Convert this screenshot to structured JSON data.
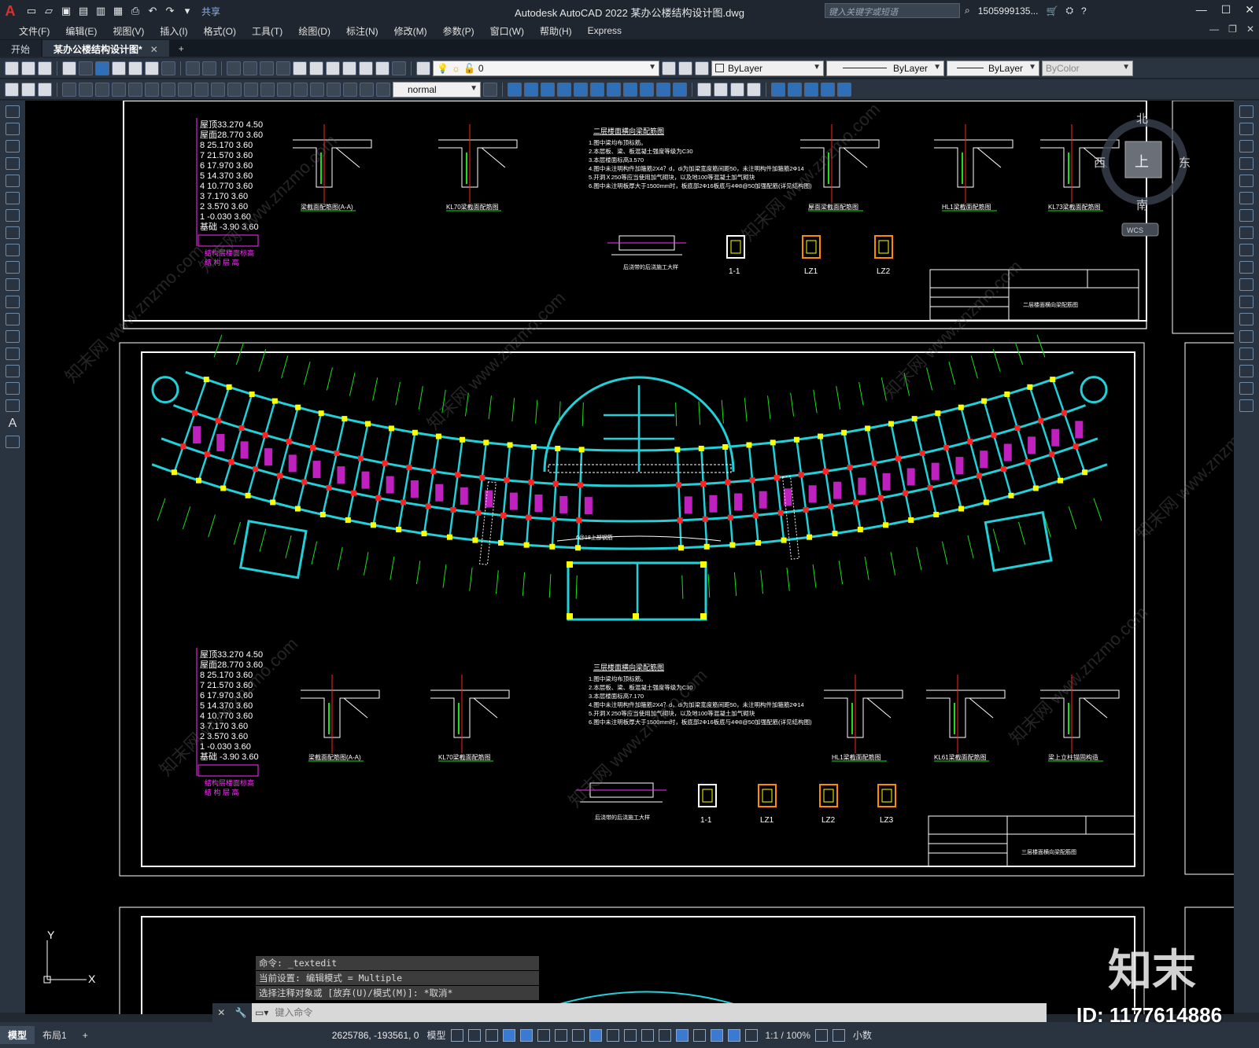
{
  "titlebar": {
    "app_title": "Autodesk AutoCAD 2022    某办公楼结构设计图.dwg",
    "share_label": "共享",
    "search_placeholder": "键入关键字或短语",
    "account": "1505999135...",
    "logo": "A"
  },
  "menu": [
    "文件(F)",
    "编辑(E)",
    "视图(V)",
    "插入(I)",
    "格式(O)",
    "工具(T)",
    "绘图(D)",
    "标注(N)",
    "修改(M)",
    "参数(P)",
    "窗口(W)",
    "帮助(H)",
    "Express"
  ],
  "tabs": {
    "start": "开始",
    "active": "某办公楼结构设计图*",
    "close": "✕",
    "add": "+"
  },
  "toolbar": {
    "layer_value": "0",
    "style_value": "normal",
    "color_value": "ByLayer",
    "linetype_value": "ByLayer",
    "lineweight_value": "ByLayer",
    "plotstyle_value": "ByColor"
  },
  "viewcube": {
    "north": "北",
    "south": "南",
    "east": "东",
    "west": "西",
    "top": "上",
    "wcs": "WCS"
  },
  "drawing": {
    "elev_table_1": [
      "屋顶33.270 4.50",
      "屋面28.770 3.60",
      "8 25.170 3.60",
      "7 21.570 3.60",
      "6 17.970 3.60",
      "5 14.370 3.60",
      "4 10.770 3.60",
      "3 7.170 3.60",
      "2 3.570 3.60",
      "1 -0.030 3.60",
      "基础 -3.90 3.60"
    ],
    "elev_caption": [
      "结构层楼面标高",
      "结 构 层 高"
    ],
    "title_top": "二层楼面横向梁配筋图",
    "title_bottom": "三层楼面横向梁配筋图",
    "notes_top": [
      "1.图中梁均布顶标筋。",
      "2.本层板、梁、板混凝土强度等级为C30",
      "3.本层楼面标高3.570",
      "4.图中未注明构件加箍筋2X4？d，di为加梁宽度筋间距50，未注明构件加箍筋2Ф14",
      "5.开洞Ｘ250等应当使用加气砌块，以及地100等混凝土加气砌块",
      "6.图中未注明板厚大于1500mm时，板底部2Ф16板底与4Ф8@50加强配筋(详见结构图)"
    ],
    "notes_bottom": [
      "1.图中梁均布顶标筋。",
      "2.本层板、梁、板混凝土强度等级为C30",
      "3.本层楼面标高7.170",
      "4.图中未注明构件加箍筋2X4？d，di为加梁宽度筋间距50，未注明构件加箍筋2Ф14",
      "5.开洞Ｘ250等应当使用加气砌块，以及地100等混凝土加气砌块",
      "6.图中未注明板厚大于1500mm时，板底部2Ф16板底与4Ф8@50加强配筋(详见结构图)"
    ],
    "details_top": [
      "梁截面配筋图(A-A)",
      "KL70梁截面配筋图",
      "屋面梁截面配筋图",
      "HL1梁截面配筋图",
      "KL73梁截面配筋图"
    ],
    "details_bottom": [
      "梁截面配筋图(A-A)",
      "KL70梁截面配筋图",
      "HL1梁截面配筋图",
      "KL61梁截面配筋图",
      "梁上立柱锚固构造"
    ],
    "sections_top": [
      "1-1",
      "LZ1",
      "LZ2"
    ],
    "sections_bottom": [
      "1-1",
      "LZ1",
      "LZ2",
      "LZ3"
    ],
    "post_pour": "后浇带的后浇施工大样",
    "center_label": "6@18上部钢筋"
  },
  "command": {
    "history": [
      "命令: _textedit",
      "当前设置: 编辑模式 = Multiple",
      "选择注释对象或 [放弃(U)/模式(M)]: *取消*"
    ],
    "placeholder": "键入命令"
  },
  "status": {
    "model_tab": "模型",
    "layout_tab": "布局1",
    "add": "+",
    "coords": "2625786, -193561, 0",
    "model_btn": "模型",
    "scale": "1:1 / 100%",
    "units": "小数"
  },
  "watermark": {
    "logo": "知末",
    "id": "ID: 1177614886",
    "site": "知末网 www.znzmo.com"
  },
  "ucs": {
    "x": "X",
    "y": "Y"
  },
  "colors": {
    "cyan": "#21d0d8",
    "magenta": "#ff2cff",
    "yellow": "#ffff00",
    "green": "#19e019",
    "red": "#ff2222",
    "white": "#ffffff"
  }
}
